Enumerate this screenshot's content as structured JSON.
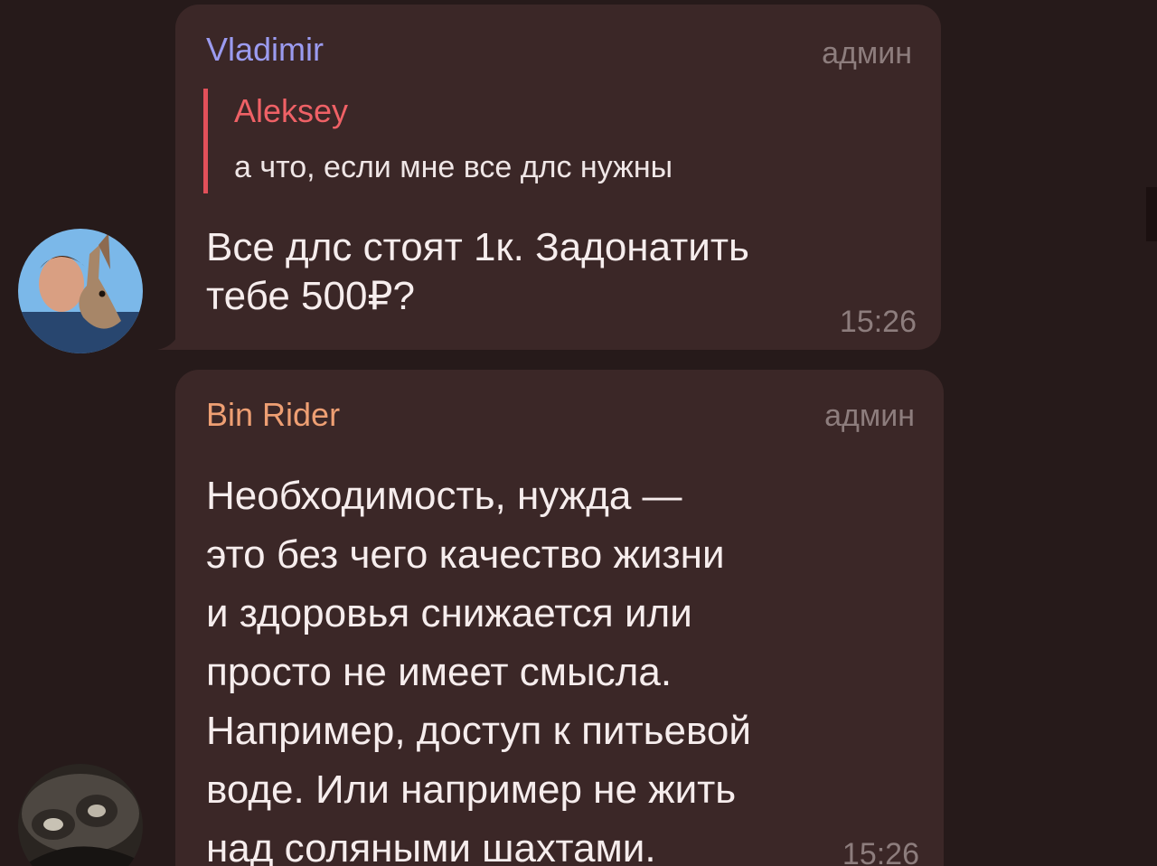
{
  "messages": [
    {
      "sender": "Vladimir",
      "role": "админ",
      "reply": {
        "author": "Aleksey",
        "text": "а что, если мне все длс нужны"
      },
      "text": "Все длс стоят 1к. Задонатить\nтебе 500₽?",
      "time": "15:26",
      "colors": {
        "sender": "#9b9bf0",
        "reply_bar": "#e2505a",
        "reply_author": "#ef6166"
      }
    },
    {
      "sender": "Bin Rider",
      "role": "админ",
      "text": "Необходимость, нужда —\nэто без чего качество жизни\nи здоровья снижается или\nпросто не имеет смысла.\nНапример, доступ к питьевой\nводе. Или например не жить\nнад соляными шахтами.",
      "time": "15:26",
      "colors": {
        "sender": "#ee9f73"
      }
    }
  ],
  "theme": {
    "background": "#261a1a",
    "bubble": "#3b2727",
    "muted_text": "#8d7d7d"
  }
}
